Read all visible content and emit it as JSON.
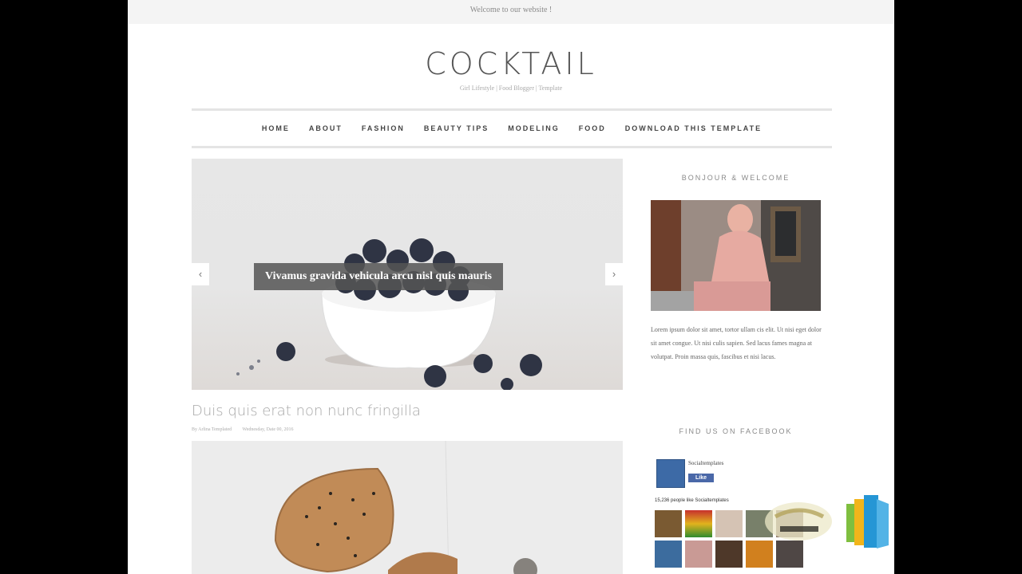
{
  "topbar": {
    "text": "Welcome to our website !"
  },
  "header": {
    "title": "COCKTAIL",
    "tagline": "Girl Lifestyle | Food Blogger | Template"
  },
  "nav": {
    "items": [
      "HOME",
      "ABOUT",
      "FASHION",
      "BEAUTY TIPS",
      "MODELING",
      "FOOD",
      "DOWNLOAD THIS TEMPLATE"
    ]
  },
  "slider": {
    "caption": "Vivamus gravida vehicula arcu nisl quis mauris",
    "prev_icon": "chevron-left-icon",
    "next_icon": "chevron-right-icon"
  },
  "post": {
    "title": "Duis quis erat non nunc fringilla",
    "author": "By Arlina Templated",
    "date": "Wednesday, Date 00, 2016"
  },
  "sidebar": {
    "welcome_title": "BONJOUR & WELCOME",
    "about_text": "Lorem ipsum dolor sit amet, tortor ullam cis elit. Ut nisi eget dolor sit amet congue. Ut nisi culis sapien. Sed lacus fames magna at volutpat. Proin massa quis, fascibus et nisi lacus.",
    "facebook_title": "FIND US ON FACEBOOK",
    "fb_name": "Socialtemplates",
    "fb_like": "Like",
    "fb_count": "15,236 people like Socialtemplates"
  },
  "colors": {
    "accent_blue": "#4a68a8",
    "nav_text": "#444444",
    "caption_bg": "#555555"
  }
}
